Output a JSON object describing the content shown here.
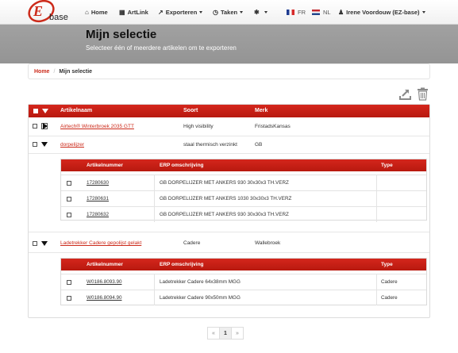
{
  "brand": {
    "logo_text": "base",
    "logo_letter": "E"
  },
  "nav": {
    "home": "Home",
    "artlink": "ArtLink",
    "exporteren": "Exporteren",
    "taken": "Taken",
    "lang_fr": "FR",
    "lang_nl": "NL",
    "user": "Irene Voordouw (EZ-base)"
  },
  "header": {
    "title": "Mijn selectie",
    "subtitle": "Selecteer één of meerdere artikelen om te exporteren"
  },
  "breadcrumb": {
    "home": "Home",
    "separator": "/",
    "current": "Mijn selectie"
  },
  "table": {
    "columns": {
      "name": "Artikelnaam",
      "soort": "Soort",
      "merk": "Merk"
    },
    "rows": [
      {
        "name": "Airtech® Winterbroek 2035 GTT",
        "soort": "High visibility",
        "merk": "FristadsKansas"
      },
      {
        "name": "dorpelijzer",
        "soort": "staal thermisch verzinkt",
        "merk": "GB"
      },
      {
        "name": "Ladetrekker Cadere gepolijst gelakt",
        "soort": "Cadere",
        "merk": "Wallebroek"
      }
    ]
  },
  "subtable": {
    "columns": {
      "nummer": "Artikelnummer",
      "erp": "ERP omschrijving",
      "type": "Type"
    },
    "group1": [
      {
        "nummer": "17280630",
        "erp": "GB DORPELIJZER MET ANKERS 930 30x30x3 TH.VERZ",
        "type": ""
      },
      {
        "nummer": "17280631",
        "erp": "GB DORPELIJZER MET ANKERS 1030 30x30x3 TH.VERZ",
        "type": ""
      },
      {
        "nummer": "17280632",
        "erp": "GB DORPELIJZER MET ANKERS 930 30x30x3 TH.VERZ",
        "type": ""
      }
    ],
    "group2": [
      {
        "nummer": "W0186.8093.90",
        "erp": "Ladetrekker Cadere 64x38mm MGG",
        "type": "Cadere"
      },
      {
        "nummer": "W0186.8094.90",
        "erp": "Ladetrekker Cadere 90x50mm MGG",
        "type": "Cadere"
      }
    ]
  },
  "pagination": {
    "prev": "«",
    "page": "1",
    "next": "»"
  },
  "colors": {
    "accent": "#cc2a1a",
    "header_band": "#9c9c9c",
    "table_header": "#c8211a"
  }
}
